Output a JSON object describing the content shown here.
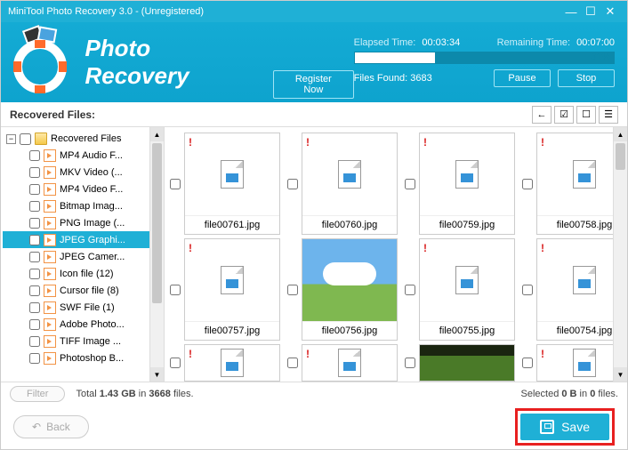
{
  "titlebar": {
    "title": "MiniTool Photo Recovery 3.0 - (Unregistered)"
  },
  "header": {
    "brand": "Photo Recovery",
    "register": "Register Now",
    "elapsed_label": "Elapsed Time:",
    "elapsed_value": "00:03:34",
    "remaining_label": "Remaining Time:",
    "remaining_value": "00:07:00",
    "progress_pct": "31%",
    "progress_width": "31%",
    "found_label": "Files Found:",
    "found_value": "3683",
    "pause": "Pause",
    "stop": "Stop"
  },
  "toolbar": {
    "heading": "Recovered Files:"
  },
  "tree": {
    "root": "Recovered Files",
    "items": [
      {
        "label": "MP4 Audio F..."
      },
      {
        "label": "MKV Video (..."
      },
      {
        "label": "MP4 Video F..."
      },
      {
        "label": "Bitmap Imag..."
      },
      {
        "label": "PNG Image (..."
      },
      {
        "label": "JPEG Graphi...",
        "selected": true
      },
      {
        "label": "JPEG Camer..."
      },
      {
        "label": "Icon file (12)"
      },
      {
        "label": "Cursor file (8)"
      },
      {
        "label": "SWF File (1)"
      },
      {
        "label": "Adobe Photo..."
      },
      {
        "label": "TIFF Image ..."
      },
      {
        "label": "Photoshop B..."
      }
    ]
  },
  "thumbs": {
    "r1": [
      "file00761.jpg",
      "file00760.jpg",
      "file00759.jpg",
      "file00758.jpg"
    ],
    "r2": [
      "file00757.jpg",
      "file00756.jpg",
      "file00755.jpg",
      "file00754.jpg"
    ]
  },
  "status": {
    "filter": "Filter",
    "total_prefix": "Total ",
    "total_size": "1.43 GB",
    "total_mid": " in ",
    "total_count": "3668",
    "total_suffix": " files.",
    "sel_prefix": "Selected ",
    "sel_size": "0 B",
    "sel_mid": " in ",
    "sel_count": "0",
    "sel_suffix": " files."
  },
  "footer": {
    "back": "Back",
    "save": "Save"
  }
}
